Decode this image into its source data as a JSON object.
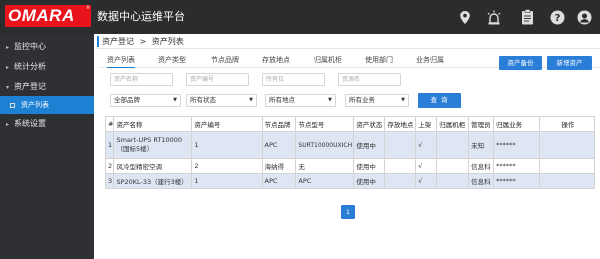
{
  "header": {
    "logo": "OMARA",
    "logo_mark": "®",
    "title": "数据中心运维平台",
    "icons": [
      "location-pin-icon",
      "alarm-light-icon",
      "clipboard-icon",
      "help-icon",
      "user-icon"
    ]
  },
  "sidebar": {
    "items": [
      {
        "label": "监控中心",
        "caret": "▸"
      },
      {
        "label": "统计分析",
        "caret": "▸"
      },
      {
        "label": "资产登记",
        "caret": "▾"
      },
      {
        "label": "资产列表",
        "caret": ""
      },
      {
        "label": "系统设置",
        "caret": "▸"
      }
    ]
  },
  "breadcrumb": {
    "parent": "资产登记",
    "sep": ">",
    "current": "资产列表"
  },
  "tabs": [
    "资产列表",
    "资产类型",
    "节点品牌",
    "存放地点",
    "归属机柜",
    "使用部门",
    "业务归属"
  ],
  "actions": {
    "backup": "资产备份",
    "add": "新增资产"
  },
  "filters": {
    "inputs": [
      "资产名称",
      "资产编号",
      "所有位",
      "资源名"
    ],
    "selects": [
      "全部品牌",
      "所有状态",
      "所有地点",
      "所有业务"
    ],
    "query": "查 询"
  },
  "table": {
    "headers": [
      "#",
      "资产名称",
      "资产编号",
      "节点品牌",
      "节点型号",
      "资产状态",
      "存放地点",
      "上架",
      "归属机柜",
      "管理员",
      "归属业务",
      "操作"
    ],
    "rows": [
      {
        "cells": [
          "1",
          "Smart-UPS RT10000\n（国标5楼）",
          "1",
          "APC",
          "SURT10000UXICH",
          "使用中",
          "",
          "√",
          "",
          "未知",
          "******",
          ""
        ]
      },
      {
        "cells": [
          "2",
          "风冷型精密空调",
          "2",
          "海纳得",
          "无",
          "使用中",
          "",
          "√",
          "",
          "信息科",
          "******",
          ""
        ]
      },
      {
        "cells": [
          "3",
          "SP20KL-33（建行3楼）",
          "1",
          "APC",
          "APC",
          "使用中",
          "",
          "√",
          "",
          "信息科",
          "******",
          ""
        ]
      }
    ]
  },
  "pagination": {
    "current": "1"
  },
  "colors": {
    "topbar": "#2b2c2e",
    "sidebar": "#2f3033",
    "accent": "#1e80d2",
    "logo": "#e8131c",
    "row_highlight": "#dfe6f3"
  }
}
